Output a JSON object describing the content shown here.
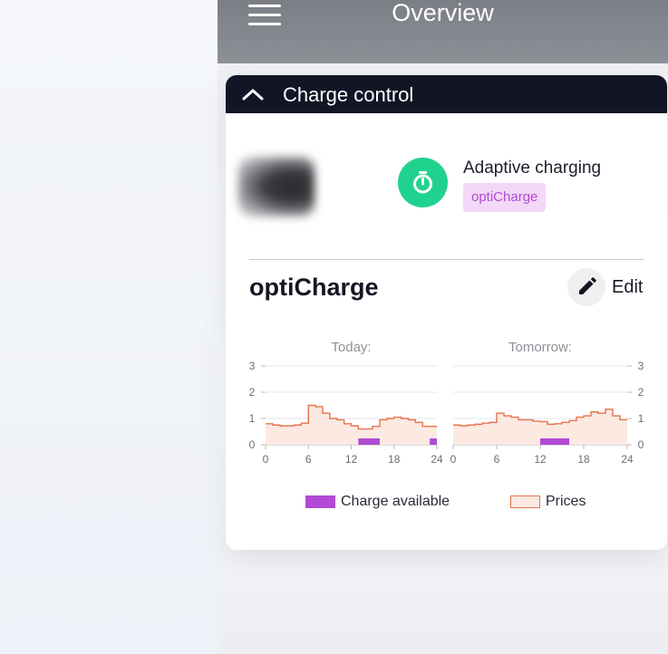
{
  "header": {
    "title": "Overview",
    "menu_icon": "hamburger-menu-icon"
  },
  "card": {
    "title": "Charge control",
    "collapse_icon": "chevron-up-icon",
    "mode": {
      "label": "Adaptive charging",
      "badge": "optiCharge",
      "icon": "timer-icon",
      "icon_color": "#21d28f"
    },
    "section_title": "optiCharge",
    "edit_label": "Edit",
    "edit_icon": "pencil-icon"
  },
  "chart_data": [
    {
      "type": "area",
      "title": "Today:",
      "x_ticks": [
        "0",
        "6",
        "12",
        "18",
        "24"
      ],
      "y_ticks": [
        "0",
        "1",
        "2",
        "3"
      ],
      "xlim": [
        0,
        24
      ],
      "ylim": [
        0,
        3
      ],
      "grid": true,
      "series": [
        {
          "name": "Prices",
          "step": true,
          "x": [
            0,
            1,
            2,
            3,
            4,
            5,
            6,
            7,
            8,
            9,
            10,
            11,
            12,
            13,
            14,
            15,
            16,
            17,
            18,
            19,
            20,
            21,
            22,
            23,
            24
          ],
          "values": [
            0.8,
            0.75,
            0.72,
            0.72,
            0.75,
            0.82,
            1.5,
            1.45,
            1.2,
            1.0,
            0.95,
            0.8,
            0.72,
            0.6,
            0.6,
            0.7,
            0.95,
            1.0,
            1.05,
            1.0,
            0.95,
            0.85,
            0.7,
            0.7,
            0.7
          ]
        },
        {
          "name": "Charge available",
          "ranges": [
            [
              13,
              16
            ],
            [
              23,
              24
            ]
          ]
        }
      ]
    },
    {
      "type": "area",
      "title": "Tomorrow:",
      "x_ticks": [
        "0",
        "6",
        "12",
        "18",
        "24"
      ],
      "y_ticks": [
        "0",
        "1",
        "2",
        "3"
      ],
      "xlim": [
        0,
        24
      ],
      "ylim": [
        0,
        3
      ],
      "grid": true,
      "series": [
        {
          "name": "Prices",
          "step": true,
          "x": [
            0,
            1,
            2,
            3,
            4,
            5,
            6,
            7,
            8,
            9,
            10,
            11,
            12,
            13,
            14,
            15,
            16,
            17,
            18,
            19,
            20,
            21,
            22,
            23,
            24
          ],
          "values": [
            0.75,
            0.72,
            0.75,
            0.78,
            0.82,
            0.85,
            1.2,
            1.1,
            1.05,
            0.95,
            0.95,
            0.9,
            0.88,
            0.78,
            0.8,
            0.85,
            0.92,
            1.05,
            1.1,
            1.25,
            1.2,
            1.35,
            1.1,
            0.95,
            0.95
          ]
        },
        {
          "name": "Charge available",
          "ranges": [
            [
              12,
              16
            ]
          ]
        }
      ]
    }
  ],
  "legend": {
    "items": [
      {
        "label": "Charge available",
        "color": "#b14ad4"
      },
      {
        "label": "Prices",
        "color": "#e8734a",
        "fill": "#fbe9e2"
      }
    ]
  },
  "colors": {
    "header_bg": "#131526",
    "accent": "#21d28f",
    "price_line": "#e8734a",
    "charge_bar": "#b14ad4"
  }
}
